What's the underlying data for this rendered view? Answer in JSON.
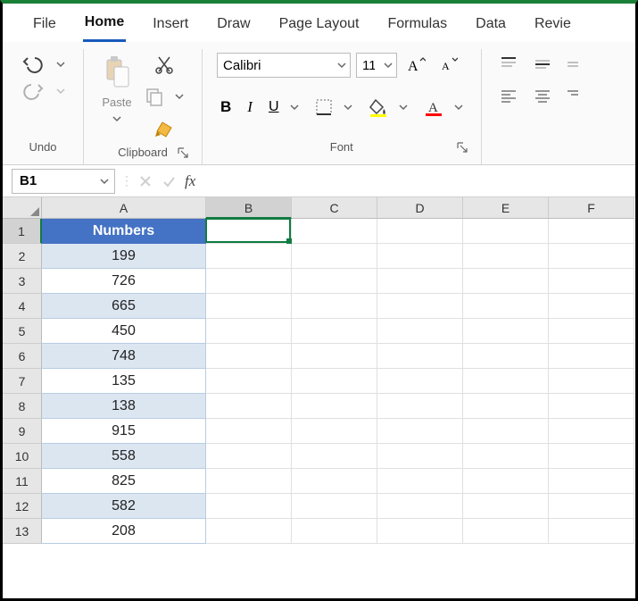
{
  "tabs": {
    "file": "File",
    "home": "Home",
    "insert": "Insert",
    "draw": "Draw",
    "page_layout": "Page Layout",
    "formulas": "Formulas",
    "data": "Data",
    "review": "Revie"
  },
  "ribbon": {
    "undo_label": "Undo",
    "clipboard_label": "Clipboard",
    "paste_label": "Paste",
    "font_label": "Font",
    "font_name": "Calibri",
    "font_size": "11",
    "bold": "B",
    "italic": "I",
    "underline": "U"
  },
  "name_box": "B1",
  "fx_label": "fx",
  "formula_value": "",
  "columns": [
    "A",
    "B",
    "C",
    "D",
    "E",
    "F"
  ],
  "active_col": "B",
  "active_row": 1,
  "table": {
    "header": "Numbers",
    "values": [
      199,
      726,
      665,
      450,
      748,
      135,
      138,
      915,
      558,
      825,
      582,
      208
    ]
  }
}
